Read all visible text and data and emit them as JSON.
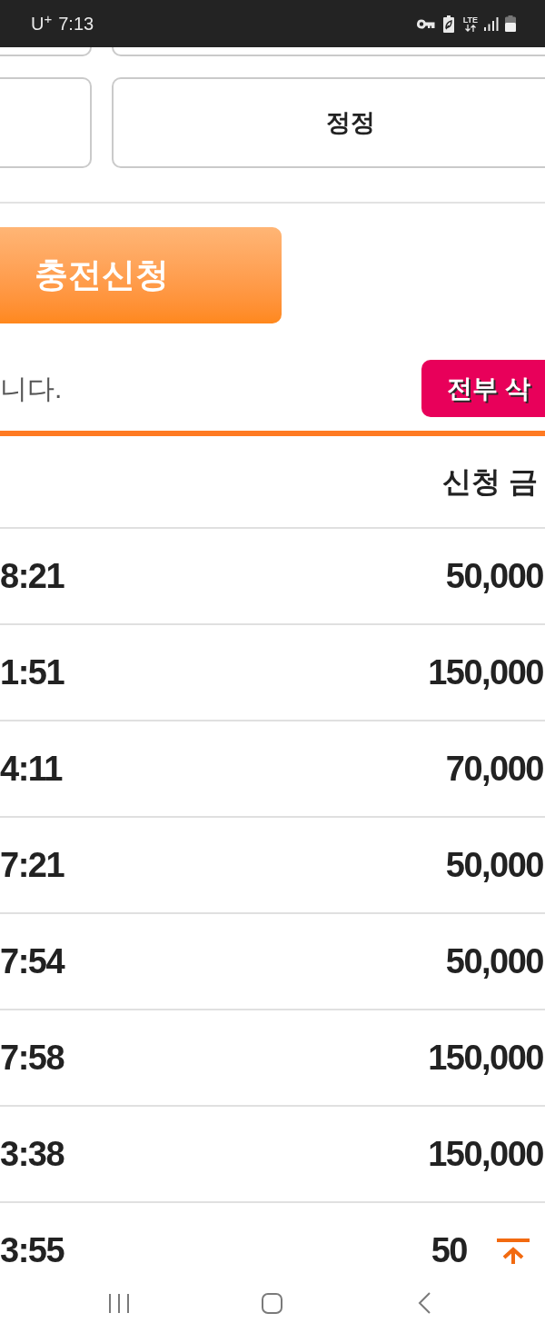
{
  "status_bar": {
    "carrier": "U$^{+}$",
    "time": "7:13",
    "network": "LTE"
  },
  "correction_button": {
    "label": "정정"
  },
  "charge_button": {
    "label": "충전신청"
  },
  "notice": {
    "text": "니다."
  },
  "delete_all_button": {
    "label": "전부 삭"
  },
  "table": {
    "column_2_header": "신청 금",
    "rows": [
      {
        "column_1": "8:21",
        "column_2": "50,000"
      },
      {
        "column_1": "1:51",
        "column_2": "150,000"
      },
      {
        "column_1": "4:11",
        "column_2": "70,000"
      },
      {
        "column_1": "7:21",
        "column_2": "50,000"
      },
      {
        "column_1": "7:54",
        "column_2": "50,000"
      },
      {
        "column_1": "7:58",
        "column_2": "150,000"
      },
      {
        "column_1": "3:38",
        "column_2": "150,000"
      },
      {
        "column_1": "3:55",
        "column_2": "50"
      }
    ]
  }
}
